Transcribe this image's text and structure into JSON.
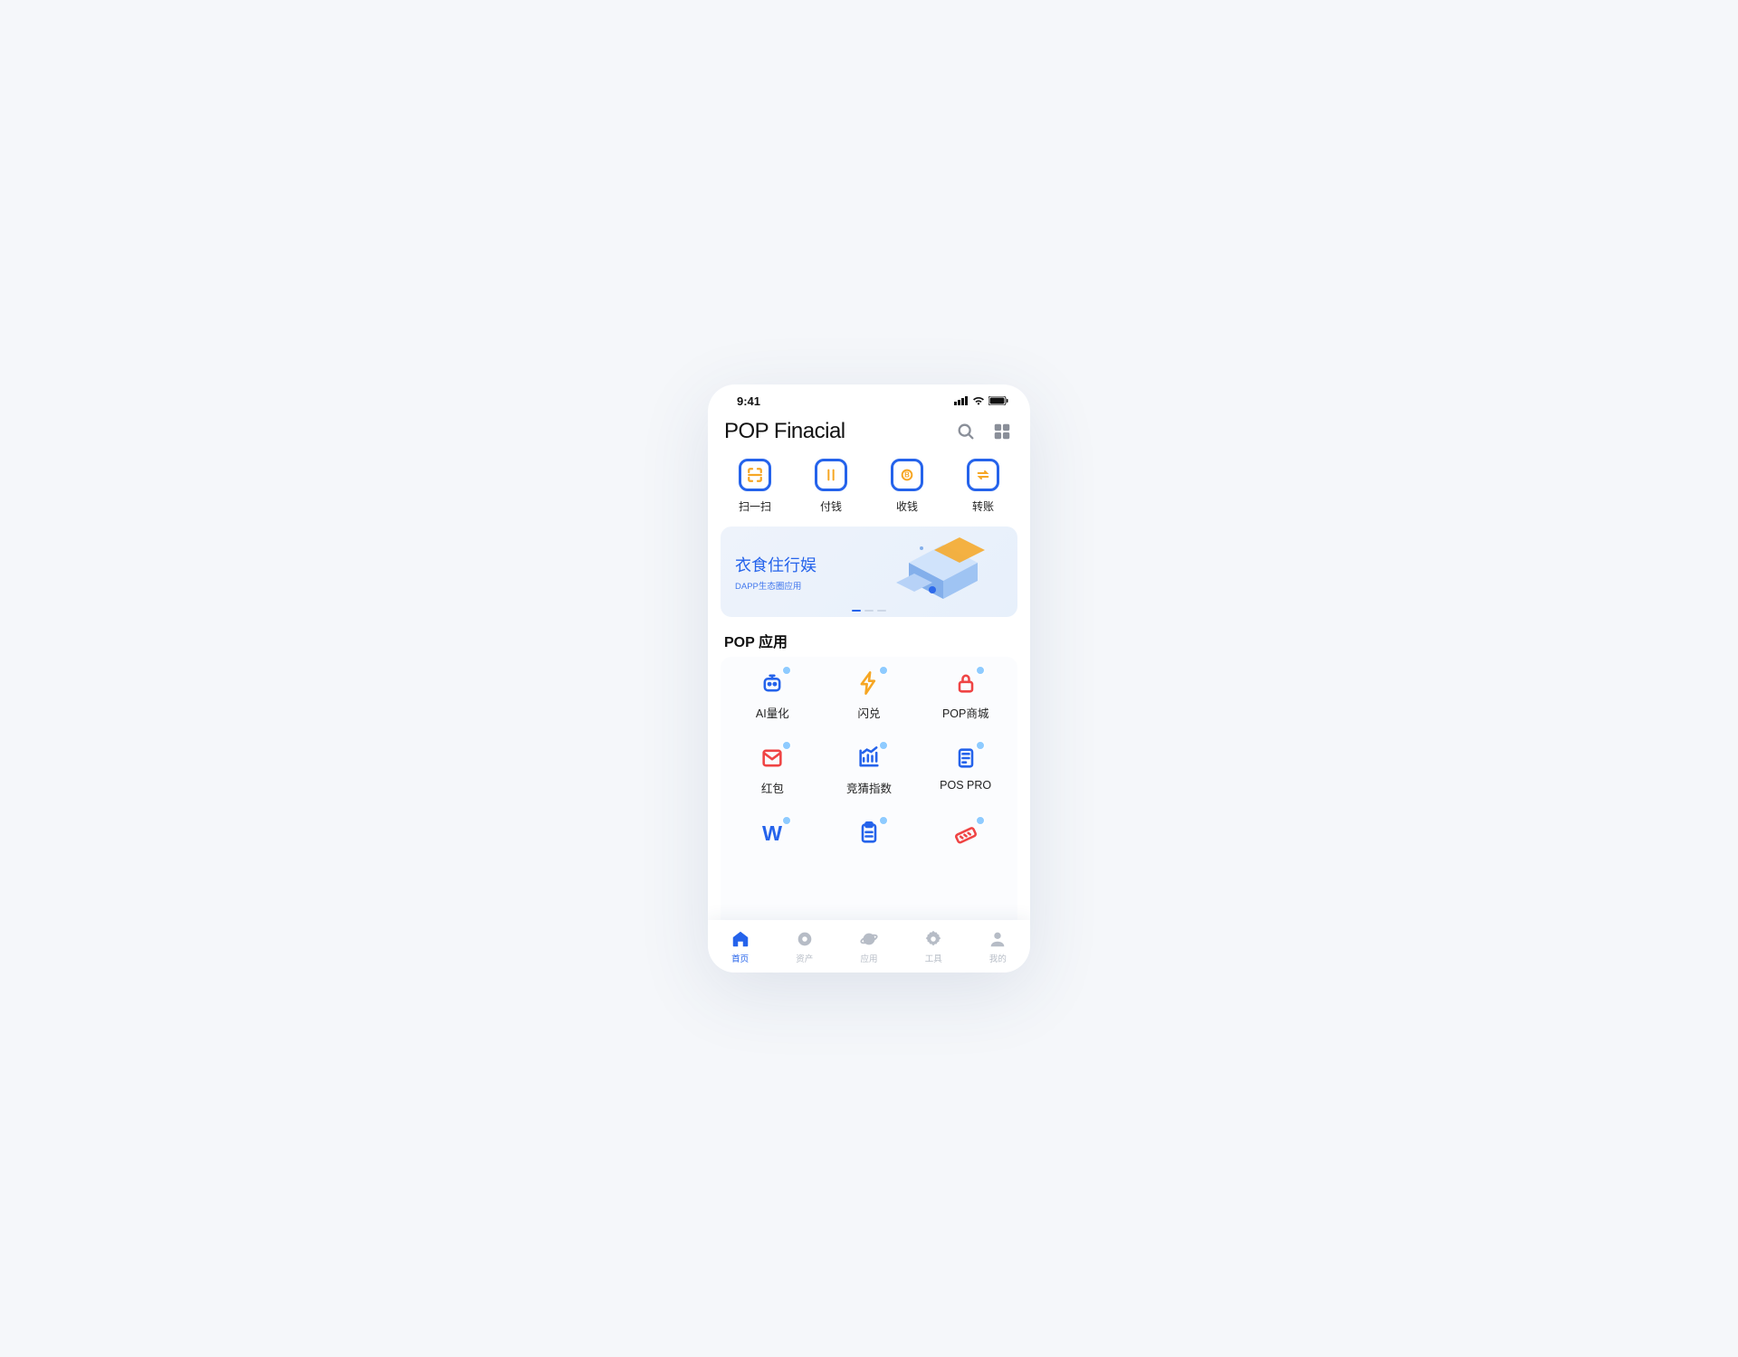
{
  "status": {
    "time": "9:41"
  },
  "header": {
    "title": "POP Finacial"
  },
  "quick": [
    {
      "label": "扫一扫",
      "icon": "scan-icon"
    },
    {
      "label": "付钱",
      "icon": "pay-icon"
    },
    {
      "label": "收钱",
      "icon": "receive-icon"
    },
    {
      "label": "转账",
      "icon": "transfer-icon"
    }
  ],
  "banner": {
    "title": "衣食住行娱",
    "subtitle": "DAPP生态圈应用"
  },
  "section_apps_title": "POP 应用",
  "apps": [
    {
      "label": "AI量化",
      "color": "#2563eb",
      "icon": "robot-icon"
    },
    {
      "label": "闪兑",
      "color": "#f6a623",
      "icon": "flash-icon"
    },
    {
      "label": "POP商城",
      "color": "#ef4444",
      "icon": "lock-cart-icon"
    },
    {
      "label": "红包",
      "color": "#ef4444",
      "icon": "envelope-icon"
    },
    {
      "label": "竞猜指数",
      "color": "#2563eb",
      "icon": "chart-up-icon"
    },
    {
      "label": "POS PRO",
      "color": "#2563eb",
      "icon": "pos-icon"
    },
    {
      "label": "",
      "color": "#2563eb",
      "icon": "w-icon"
    },
    {
      "label": "",
      "color": "#2563eb",
      "icon": "clipboard-icon"
    },
    {
      "label": "",
      "color": "#ef4444",
      "icon": "ruler-icon"
    }
  ],
  "tabs": [
    {
      "label": "首页",
      "icon": "house-icon",
      "active": true
    },
    {
      "label": "资产",
      "icon": "coin-icon",
      "active": false
    },
    {
      "label": "应用",
      "icon": "planet-icon",
      "active": false
    },
    {
      "label": "工具",
      "icon": "gear-icon",
      "active": false
    },
    {
      "label": "我的",
      "icon": "user-icon",
      "active": false
    }
  ]
}
